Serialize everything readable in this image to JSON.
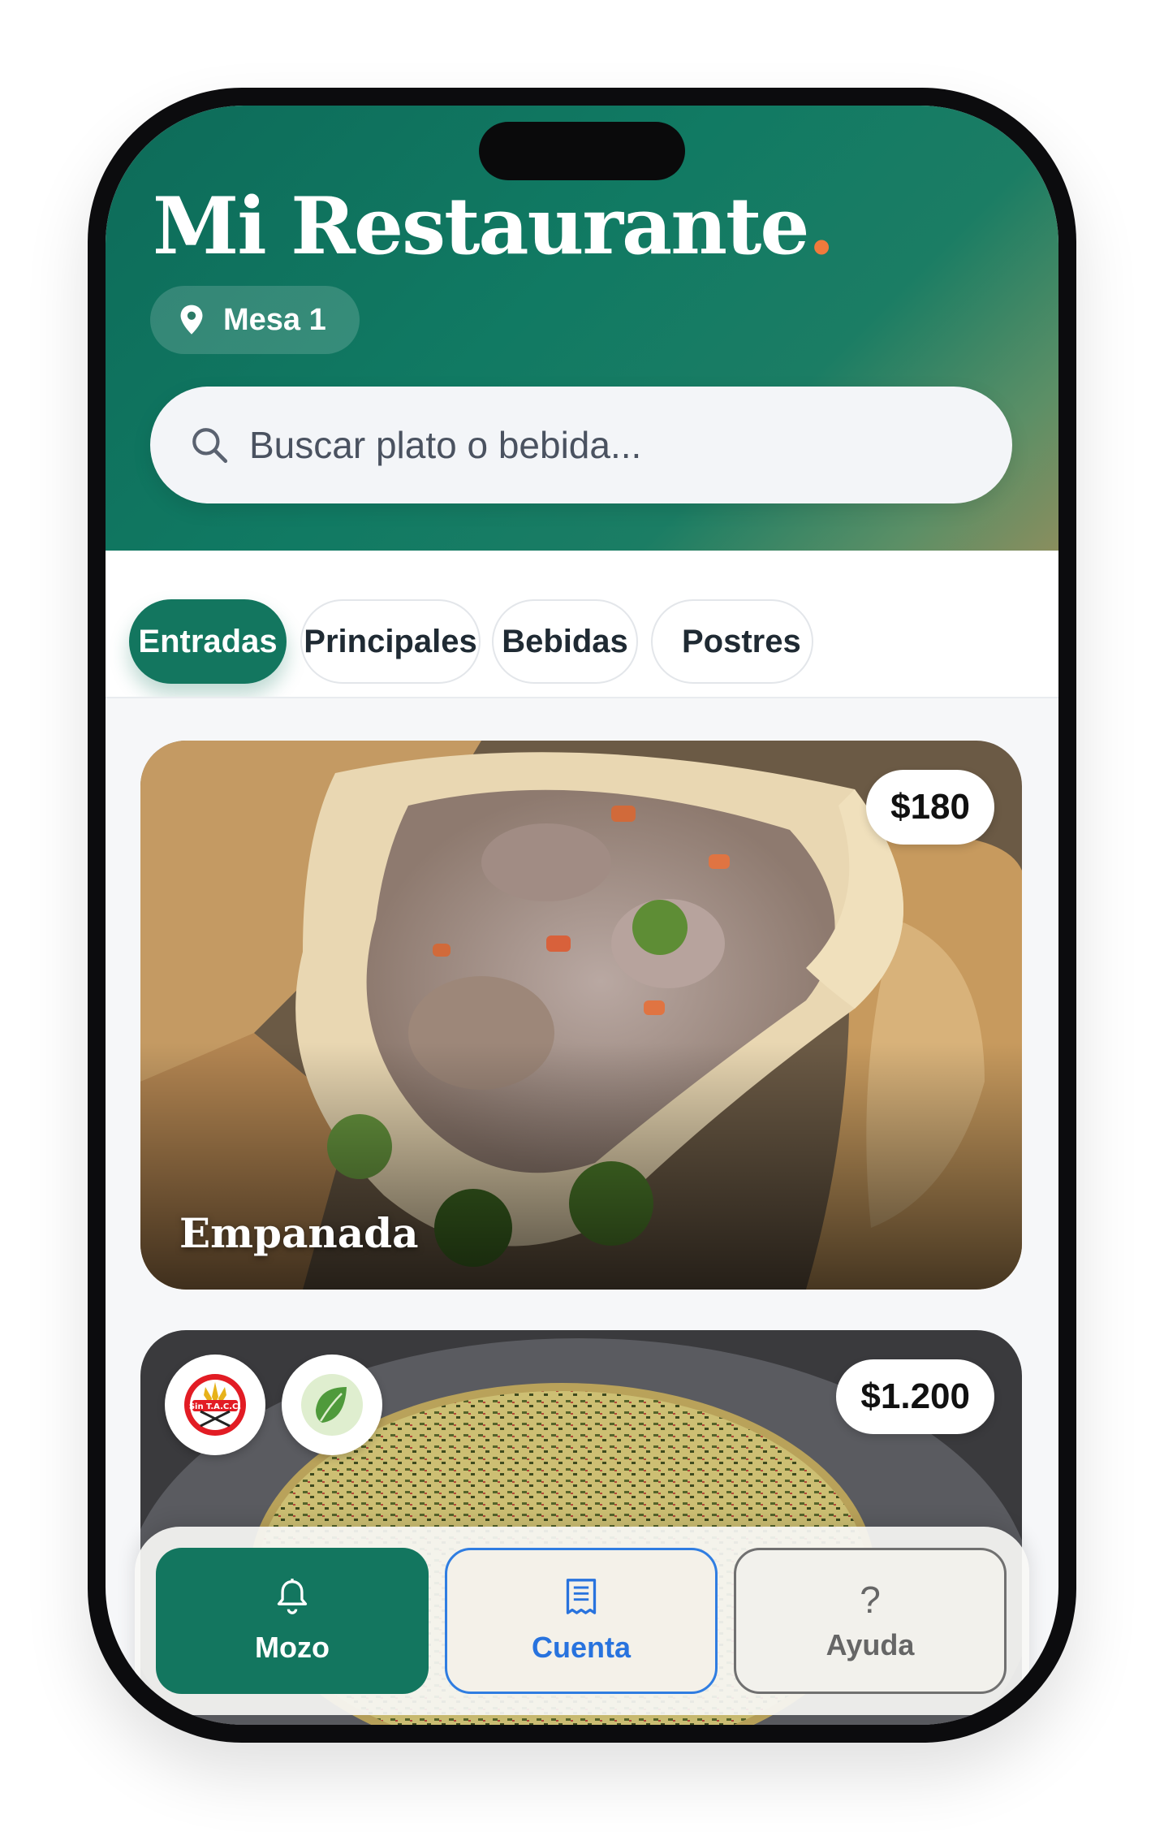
{
  "header": {
    "title": "Mi Restaurante",
    "title_dot": ".",
    "table_label": "Mesa 1"
  },
  "search": {
    "placeholder": "Buscar plato o bebida..."
  },
  "tabs": [
    {
      "label": "Entradas",
      "active": true
    },
    {
      "label": "Principales",
      "active": false
    },
    {
      "label": "Bebidas",
      "active": false
    },
    {
      "label": "Postres",
      "active": false
    }
  ],
  "dishes": [
    {
      "name": "Empanada",
      "price": "$180"
    },
    {
      "name": "",
      "price": "$1.200",
      "badges": [
        "gluten-free-badge",
        "vegetarian-leaf-icon"
      ]
    }
  ],
  "bottom_nav": {
    "mozo": "Mozo",
    "cuenta": "Cuenta",
    "ayuda": "Ayuda",
    "ayuda_icon": "?"
  },
  "colors": {
    "brand_green": "#13765f",
    "accent_orange": "#f07a3c",
    "cuenta_blue": "#2873de"
  }
}
